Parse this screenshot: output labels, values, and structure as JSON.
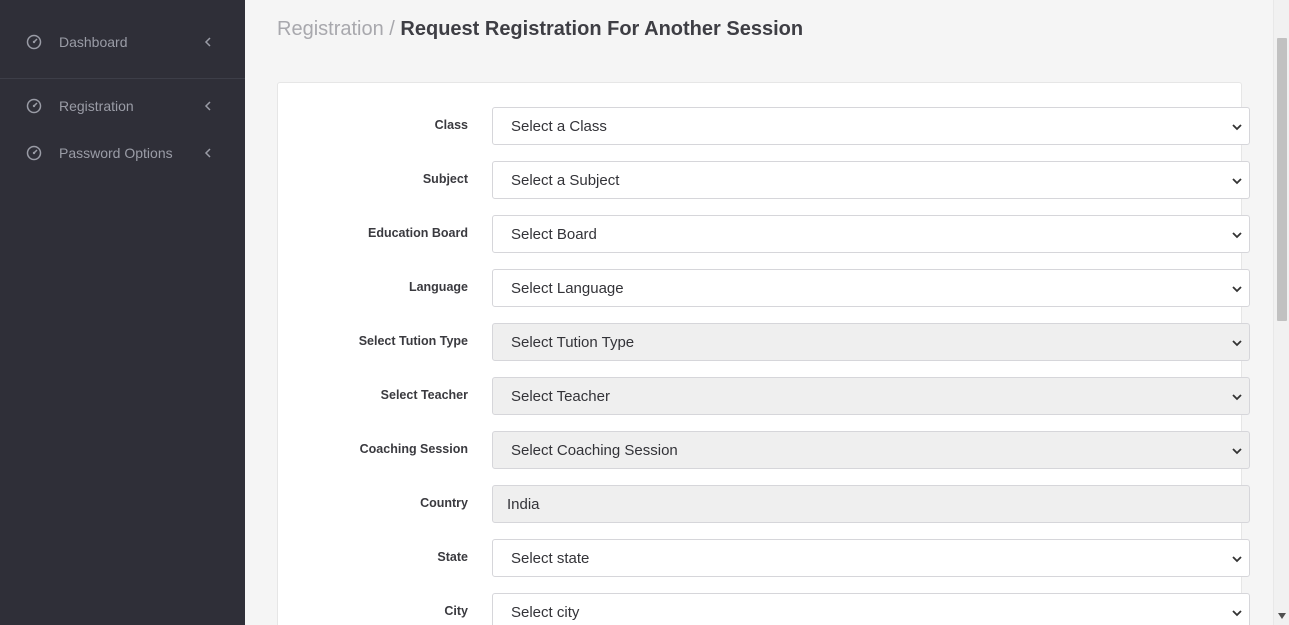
{
  "sidebar": {
    "items": [
      {
        "label": "Dashboard",
        "icon": "gauge-icon"
      },
      {
        "label": "Registration",
        "icon": "gauge-icon"
      },
      {
        "label": "Password Options",
        "icon": "gauge-icon"
      }
    ]
  },
  "breadcrumb": {
    "parent": "Registration",
    "separator": "/",
    "current": "Request Registration For Another Session"
  },
  "form": {
    "fields": [
      {
        "label": "Class",
        "value": "Select a Class",
        "type": "select",
        "disabled": false
      },
      {
        "label": "Subject",
        "value": "Select a Subject",
        "type": "select",
        "disabled": false
      },
      {
        "label": "Education Board",
        "value": "Select Board",
        "type": "select",
        "disabled": false
      },
      {
        "label": "Language",
        "value": "Select Language",
        "type": "select",
        "disabled": false
      },
      {
        "label": "Select Tution Type",
        "value": "Select Tution Type",
        "type": "select",
        "disabled": true
      },
      {
        "label": "Select Teacher",
        "value": "Select Teacher",
        "type": "select",
        "disabled": true
      },
      {
        "label": "Coaching Session",
        "value": "Select Coaching Session",
        "type": "select",
        "disabled": true
      },
      {
        "label": "Country",
        "value": "India",
        "type": "text",
        "disabled": true
      },
      {
        "label": "State",
        "value": "Select state",
        "type": "select",
        "disabled": false
      },
      {
        "label": "City",
        "value": "Select city",
        "type": "select",
        "disabled": false
      }
    ]
  },
  "colors": {
    "sidebar_bg": "#2f2f38",
    "sidebar_text": "#9a9ca6",
    "page_bg": "#f5f5f5",
    "disabled_field_bg": "#efefef"
  }
}
